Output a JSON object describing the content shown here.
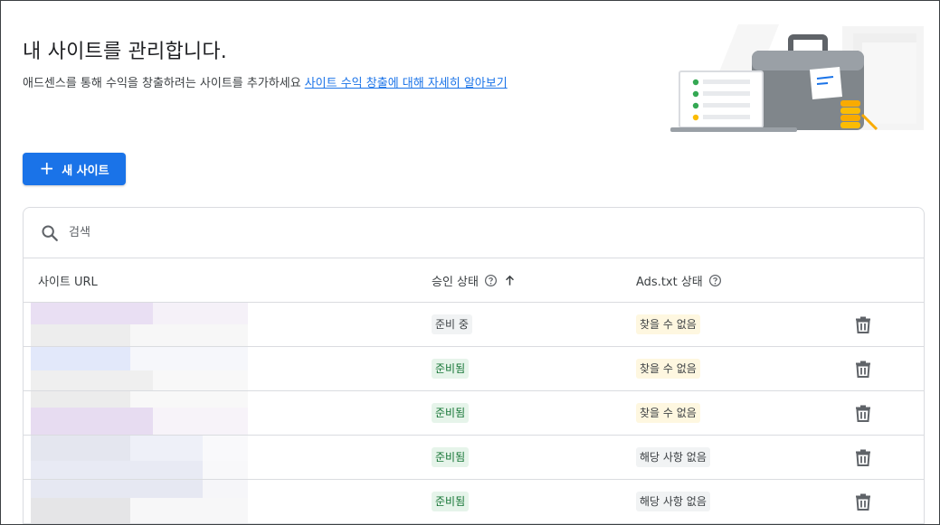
{
  "header": {
    "title": "내 사이트를 관리합니다.",
    "subtitle": "애드센스를 통해 수익을 창출하려는 사이트를 추가하세요",
    "learn_more_link": "사이트 수익 창출에 대해 자세히 알아보기"
  },
  "actions": {
    "new_site_label": "새 사이트"
  },
  "search": {
    "placeholder": "검색"
  },
  "table": {
    "columns": {
      "url": "사이트 URL",
      "approval": "승인 상태",
      "adstxt": "Ads.txt 상태"
    },
    "rows": [
      {
        "approval": "준비 중",
        "adstxt": "찾을 수 없음"
      },
      {
        "approval": "준비됨",
        "adstxt": "찾을 수 없음"
      },
      {
        "approval": "준비됨",
        "adstxt": "찾을 수 없음"
      },
      {
        "approval": "준비됨",
        "adstxt": "해당 사항 없음"
      },
      {
        "approval": "준비됨",
        "adstxt": "해당 사항 없음"
      }
    ]
  },
  "icons": {
    "search": "search-icon",
    "help": "help-icon",
    "sort": "arrow-up-icon",
    "delete": "trash-icon",
    "add": "plus-icon"
  },
  "colors": {
    "primary": "#1a73e8",
    "ready_bg": "#e6f4ea",
    "ready_text": "#137333",
    "warning_bg": "#fef7e0",
    "neutral_bg": "#f1f3f4"
  }
}
